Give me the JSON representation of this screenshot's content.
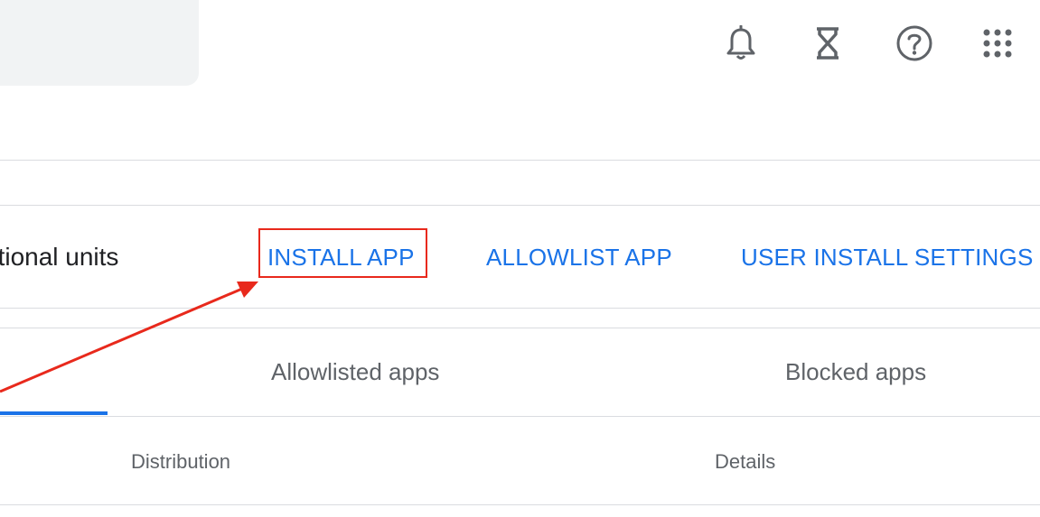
{
  "header": {
    "icons": [
      {
        "name": "notifications-bell-icon"
      },
      {
        "name": "hourglass-icon"
      },
      {
        "name": "help-icon"
      },
      {
        "name": "apps-grid-icon"
      }
    ]
  },
  "toolbar": {
    "org_units_label": "ational units",
    "install_app": "INSTALL APP",
    "allowlist_app": "ALLOWLIST APP",
    "user_install_settings": "USER INSTALL SETTINGS"
  },
  "tabs": [
    {
      "label": "Allowlisted apps"
    },
    {
      "label": "Blocked apps"
    }
  ],
  "table": {
    "columns": [
      "Distribution",
      "Details"
    ]
  },
  "colors": {
    "link": "#1a73e8",
    "highlight": "#e8291c",
    "arrow": "#e8291c",
    "tab_indicator": "#1a73e8"
  }
}
